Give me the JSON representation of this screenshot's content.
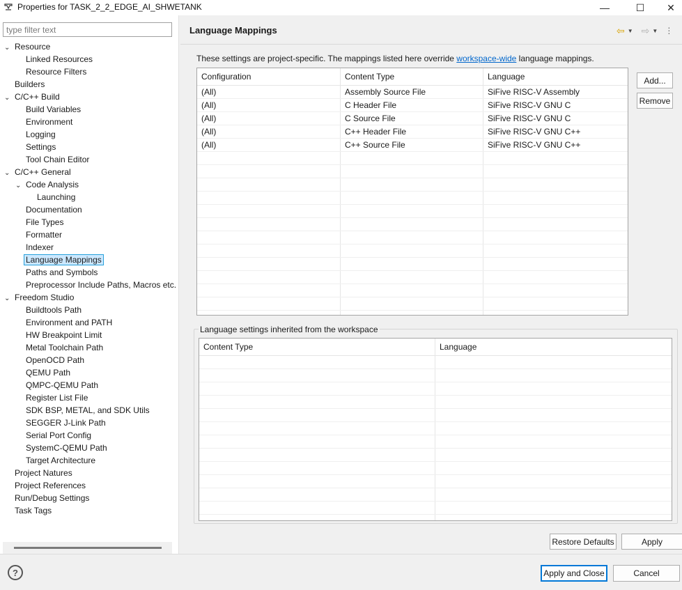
{
  "window": {
    "title": "Properties for TASK_2_2_EDGE_AI_SHWETANK",
    "min_glyph": "—",
    "max_glyph": "☐",
    "close_glyph": "✕"
  },
  "filter": {
    "placeholder": "type filter text",
    "value": ""
  },
  "tree": [
    {
      "label": "Resource",
      "level": 0,
      "twisty": "expanded"
    },
    {
      "label": "Linked Resources",
      "level": 1
    },
    {
      "label": "Resource Filters",
      "level": 1
    },
    {
      "label": "Builders",
      "level": 0
    },
    {
      "label": "C/C++ Build",
      "level": 0,
      "twisty": "expanded"
    },
    {
      "label": "Build Variables",
      "level": 1
    },
    {
      "label": "Environment",
      "level": 1
    },
    {
      "label": "Logging",
      "level": 1
    },
    {
      "label": "Settings",
      "level": 1
    },
    {
      "label": "Tool Chain Editor",
      "level": 1
    },
    {
      "label": "C/C++ General",
      "level": 0,
      "twisty": "expanded"
    },
    {
      "label": "Code Analysis",
      "level": 1,
      "twisty": "expanded"
    },
    {
      "label": "Launching",
      "level": 2
    },
    {
      "label": "Documentation",
      "level": 1
    },
    {
      "label": "File Types",
      "level": 1
    },
    {
      "label": "Formatter",
      "level": 1
    },
    {
      "label": "Indexer",
      "level": 1
    },
    {
      "label": "Language Mappings",
      "level": 1,
      "selected": true
    },
    {
      "label": "Paths and Symbols",
      "level": 1
    },
    {
      "label": "Preprocessor Include Paths, Macros etc.",
      "level": 1
    },
    {
      "label": "Freedom Studio",
      "level": 0,
      "twisty": "expanded"
    },
    {
      "label": "Buildtools Path",
      "level": 1
    },
    {
      "label": "Environment and PATH",
      "level": 1
    },
    {
      "label": "HW Breakpoint Limit",
      "level": 1
    },
    {
      "label": "Metal Toolchain Path",
      "level": 1
    },
    {
      "label": "OpenOCD Path",
      "level": 1
    },
    {
      "label": "QEMU Path",
      "level": 1
    },
    {
      "label": "QMPC-QEMU Path",
      "level": 1
    },
    {
      "label": "Register List File",
      "level": 1
    },
    {
      "label": "SDK BSP, METAL, and SDK Utils",
      "level": 1
    },
    {
      "label": "SEGGER J-Link Path",
      "level": 1
    },
    {
      "label": "Serial Port Config",
      "level": 1
    },
    {
      "label": "SystemC-QEMU Path",
      "level": 1
    },
    {
      "label": "Target Architecture",
      "level": 1
    },
    {
      "label": "Project Natures",
      "level": 0
    },
    {
      "label": "Project References",
      "level": 0
    },
    {
      "label": "Run/Debug Settings",
      "level": 0
    },
    {
      "label": "Task Tags",
      "level": 0
    }
  ],
  "page": {
    "title": "Language Mappings",
    "desc_before": "These settings are project-specific.  The mappings listed here override ",
    "desc_link": "workspace-wide",
    "desc_after": " language mappings."
  },
  "mappings": {
    "columns": [
      "Configuration",
      "Content Type",
      "Language"
    ],
    "rows": [
      [
        "(All)",
        "Assembly Source File",
        "SiFive RISC-V Assembly"
      ],
      [
        "(All)",
        "C Header File",
        "SiFive RISC-V GNU C"
      ],
      [
        "(All)",
        "C Source File",
        "SiFive RISC-V GNU C"
      ],
      [
        "(All)",
        "C++ Header File",
        "SiFive RISC-V GNU C++"
      ],
      [
        "(All)",
        "C++ Source File",
        "SiFive RISC-V GNU C++"
      ]
    ]
  },
  "buttons": {
    "add": "Add...",
    "remove": "Remove",
    "restore_defaults": "Restore Defaults",
    "apply": "Apply",
    "apply_and_close": "Apply and Close",
    "cancel": "Cancel"
  },
  "inherited": {
    "legend": "Language settings inherited from the workspace",
    "columns": [
      "Content Type",
      "Language"
    ],
    "rows": []
  },
  "icons": {
    "back": "⇦",
    "forward": "⇨",
    "dropdown": "▼",
    "menu": "⋮",
    "help": "?",
    "expanded": "⌄",
    "collapsed": "›"
  },
  "colors": {
    "selection_bg": "#cce8ff",
    "selection_border": "#26a0da",
    "link": "#0066cc",
    "default_button_border": "#0078d7"
  }
}
